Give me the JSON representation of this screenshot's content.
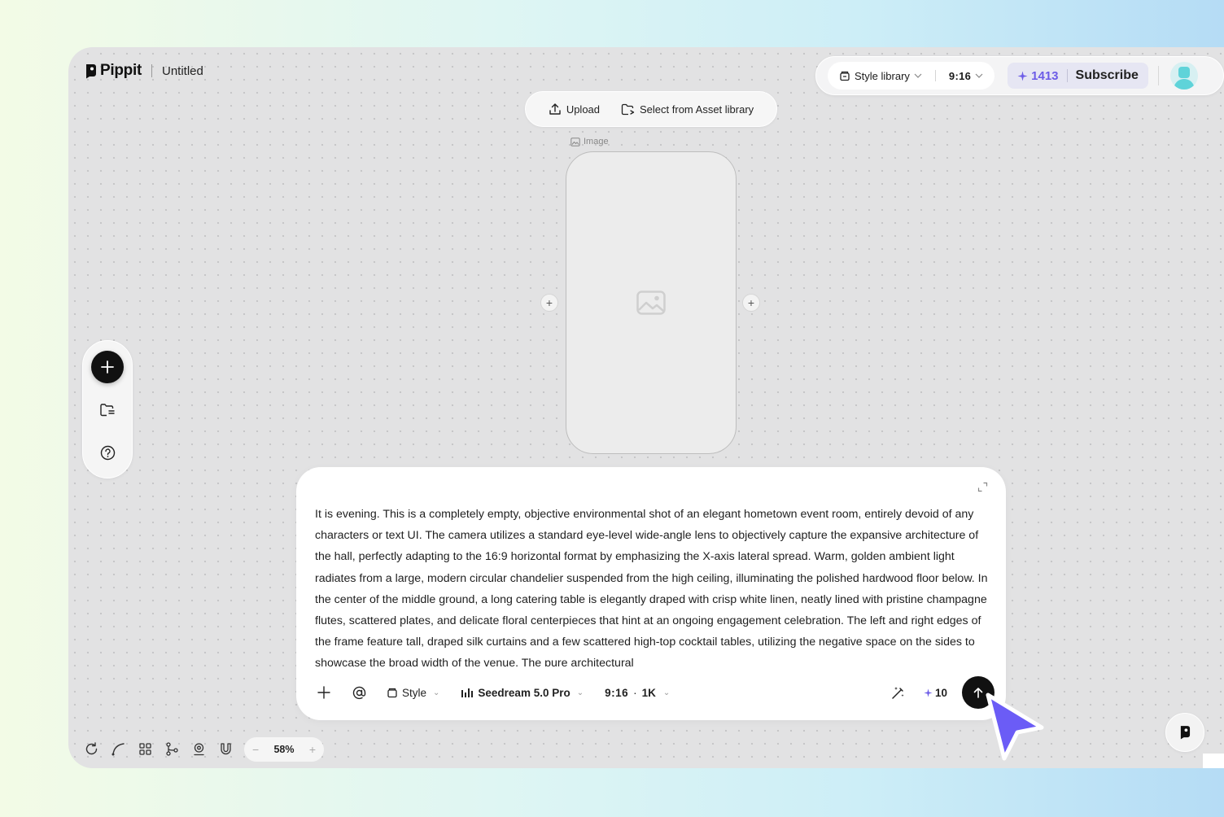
{
  "header": {
    "brand": "Pippit",
    "document_title": "Untitled"
  },
  "top_bar": {
    "style_library_label": "Style library",
    "aspect_ratio": "9:16",
    "credits": "1413",
    "subscribe_label": "Subscribe"
  },
  "upload_bar": {
    "upload_label": "Upload",
    "asset_library_label": "Select from Asset library"
  },
  "canvas_node": {
    "label": "Image"
  },
  "prompt": {
    "text": "It is evening. This is a completely empty, objective environmental shot of an elegant hometown event room, entirely devoid of any characters or text UI. The camera utilizes a standard eye-level wide-angle lens to objectively capture the expansive architecture of the hall, perfectly adapting to the 16:9 horizontal format by emphasizing the X-axis lateral spread. Warm, golden ambient light radiates from a large, modern circular chandelier suspended from the high ceiling, illuminating the polished hardwood floor below. In the center of the middle ground, a long catering table is elegantly draped with crisp white linen, neatly lined with pristine champagne flutes, scattered plates, and delicate floral centerpieces that hint at an ongoing engagement celebration. The left and right edges of the frame feature tall, draped silk curtains and a few scattered high-top cocktail tables, utilizing the negative space on the sides to showcase the broad width of the venue. The pure architectural",
    "style_label": "Style",
    "model_label": "Seedream 5.0 Pro",
    "ratio_label": "9:16",
    "resolution_label": "1K",
    "cost": "10"
  },
  "zoom": {
    "level": "58%"
  },
  "colors": {
    "accent": "#6c5ce7",
    "cursor": "#6b5cf6",
    "canvas_bg": "#e2e2e3"
  }
}
